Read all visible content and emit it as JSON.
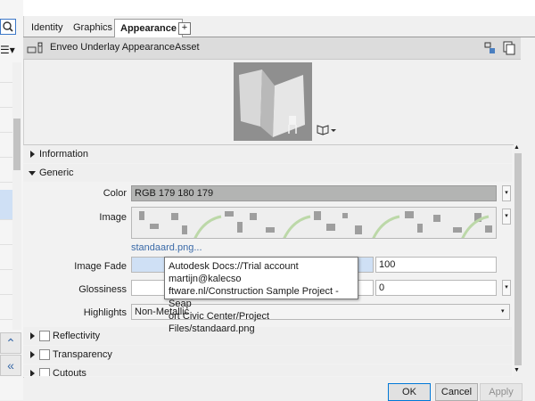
{
  "tabs": [
    {
      "label": "Identity"
    },
    {
      "label": "Graphics"
    },
    {
      "label": "Appearance"
    }
  ],
  "tab_add_label": "+",
  "asset": {
    "name": "Enveo Underlay AppearanceAsset"
  },
  "sections": {
    "information": "Information",
    "generic": "Generic",
    "reflectivity": "Reflectivity",
    "transparency": "Transparency",
    "cutouts": "Cutouts"
  },
  "generic": {
    "color_label": "Color",
    "color_value": "RGB 179 180 179",
    "color_swatch": "#b3b4b3",
    "image_label": "Image",
    "image_link": "standaard.png...",
    "image_fade_label": "Image Fade",
    "image_fade_value": "100",
    "glossiness_label": "Glossiness",
    "glossiness_value": "0",
    "highlights_label": "Highlights",
    "highlights_value": "Non-Metallic"
  },
  "tooltip": {
    "lines": [
      "Autodesk Docs://Trial account martijn@kalecso",
      "ftware.nl/Construction  Sample Project - Seap",
      "ort Civic Center/Project Files/standaard.png"
    ]
  },
  "buttons": {
    "ok": "OK",
    "cancel": "Cancel",
    "apply": "Apply"
  },
  "colors": {
    "accent": "#0078d7",
    "link": "#3a6aa8"
  }
}
